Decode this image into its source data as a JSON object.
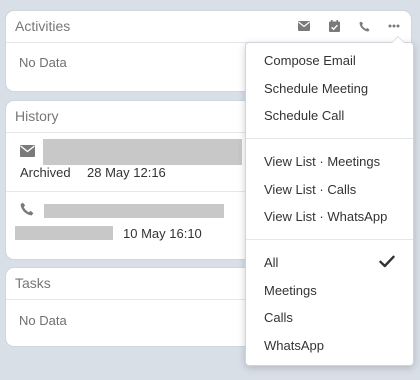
{
  "activities": {
    "title": "Activities",
    "empty_text": "No Data",
    "header_icons": [
      "envelope-icon",
      "calendar-check-icon",
      "phone-icon",
      "ellipsis-icon"
    ]
  },
  "history": {
    "title": "History",
    "entries": [
      {
        "icon": "envelope-icon",
        "status": "Archived",
        "date": "28 May 12:16"
      },
      {
        "icon": "phone-icon",
        "date": "10 May 16:10"
      }
    ]
  },
  "tasks": {
    "title": "Tasks",
    "empty_text": "No Data"
  },
  "dropdown": {
    "create_items": [
      "Compose Email",
      "Schedule Meeting",
      "Schedule Call"
    ],
    "view_items": [
      "View List · Meetings",
      "View List · Calls",
      "View List · WhatsApp"
    ],
    "filter_items": [
      "All",
      "Meetings",
      "Calls",
      "WhatsApp"
    ],
    "selected_filter": "All"
  },
  "colors": {
    "background": "#d9dfe7",
    "panel": "#ffffff",
    "icon": "#7a7a7a",
    "redacted": "#c8c8c8"
  }
}
